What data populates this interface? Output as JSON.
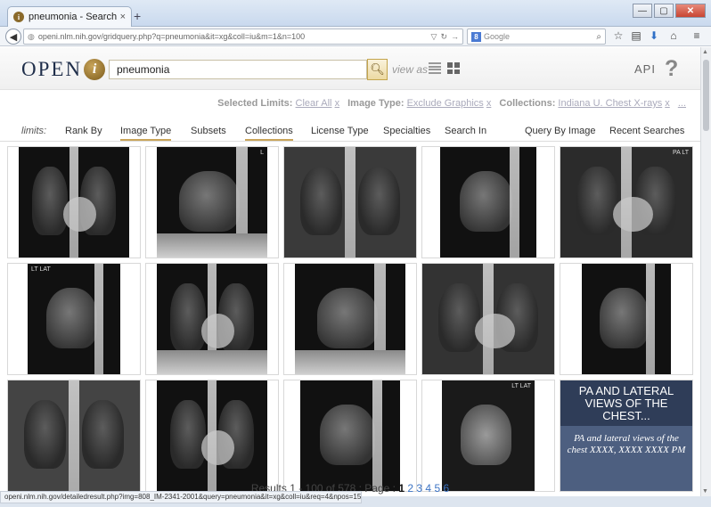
{
  "browser": {
    "tab_title": "pneumonia - Search Result...",
    "tab_close": "×",
    "new_tab": "+",
    "url": "openi.nlm.nih.gov/gridquery.php?q=pneumonia&it=xg&coll=iu&m=1&n=100",
    "search_placeholder": "Google",
    "win_min": "—",
    "win_max": "▢",
    "win_close": "✕"
  },
  "header": {
    "logo_text": "OPEN",
    "logo_i": "i",
    "query": "pneumonia",
    "view_as": "view as",
    "api": "API",
    "help": "?"
  },
  "limits": {
    "selected_label": "Selected Limits:",
    "clear_all": "Clear All",
    "x": "x",
    "image_type_label": "Image Type:",
    "image_type_value": "Exclude Graphics",
    "collections_label": "Collections:",
    "collections_value": "Indiana U. Chest X-rays",
    "more": "..."
  },
  "tabs": {
    "limits": "limits:",
    "rank_by": "Rank By",
    "image_type": "Image Type",
    "subsets": "Subsets",
    "collections": "Collections",
    "license_type": "License Type",
    "specialties": "Specialties",
    "search_in": "Search In",
    "query_by_image": "Query By Image",
    "recent_searches": "Recent Searches"
  },
  "results": {
    "tags": [
      "",
      "L",
      "",
      "",
      "PA LT",
      "LT LAT",
      "",
      "",
      "",
      "",
      "",
      "",
      "",
      "LT LAT"
    ],
    "caption_title": "PA AND LATERAL VIEWS OF THE CHEST...",
    "caption_body": "PA and lateral views of the chest XXXX, XXXX XXXX PM"
  },
  "pager": {
    "results_text": "Results 1 - 100 of 578",
    "page_label": ": Page :",
    "current": "1",
    "pages": [
      "2",
      "3",
      "4",
      "5",
      "6"
    ]
  },
  "status": {
    "url": "openi.nlm.nih.gov/detailedresult.php?img=808_IM-2341-2001&query=pneumonia&it=xg&coll=iu&req=4&npos=15"
  }
}
